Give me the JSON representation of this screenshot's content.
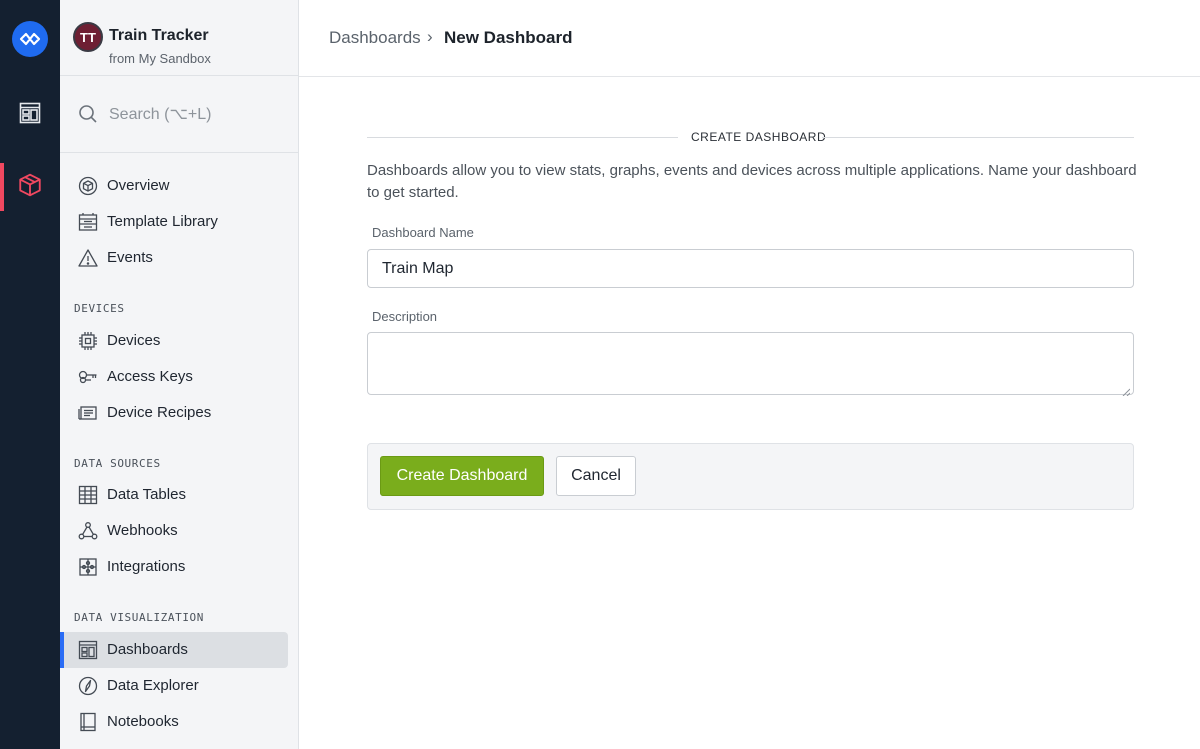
{
  "app": {
    "name": "Train Tracker",
    "subtitle": "from My Sandbox",
    "avatar_text": "TT"
  },
  "search": {
    "placeholder": "Search (⌥+L)"
  },
  "nav": {
    "top_items": [
      {
        "label": "Overview",
        "icon": "package-circle-icon"
      },
      {
        "label": "Template Library",
        "icon": "template-library-icon"
      },
      {
        "label": "Events",
        "icon": "warning-triangle-icon"
      }
    ],
    "sections": [
      {
        "title": "DEVICES",
        "items": [
          {
            "label": "Devices",
            "icon": "chip-icon"
          },
          {
            "label": "Access Keys",
            "icon": "key-icon"
          },
          {
            "label": "Device Recipes",
            "icon": "recipe-icon"
          }
        ]
      },
      {
        "title": "DATA SOURCES",
        "items": [
          {
            "label": "Data Tables",
            "icon": "table-icon"
          },
          {
            "label": "Webhooks",
            "icon": "webhook-icon"
          },
          {
            "label": "Integrations",
            "icon": "puzzle-icon"
          }
        ]
      },
      {
        "title": "DATA VISUALIZATION",
        "items": [
          {
            "label": "Dashboards",
            "icon": "dashboard-icon",
            "active": true
          },
          {
            "label": "Data Explorer",
            "icon": "compass-icon"
          },
          {
            "label": "Notebooks",
            "icon": "notebook-icon"
          }
        ]
      }
    ]
  },
  "breadcrumb": {
    "parent": "Dashboards",
    "separator": "›",
    "current": "New Dashboard"
  },
  "form": {
    "section_title": "CREATE DASHBOARD",
    "description": "Dashboards allow you to view stats, graphs, events and devices across multiple applications. Name your dashboard to get started.",
    "name_label": "Dashboard Name",
    "name_value": "Train Map",
    "description_label": "Description",
    "description_value": "",
    "create_label": "Create Dashboard",
    "cancel_label": "Cancel"
  },
  "colors": {
    "rail_bg": "#142030",
    "brand_blue": "#1f6bf0",
    "active_red": "#f04860",
    "primary_green": "#7aad1c",
    "active_indicator": "#2a6cf5"
  }
}
